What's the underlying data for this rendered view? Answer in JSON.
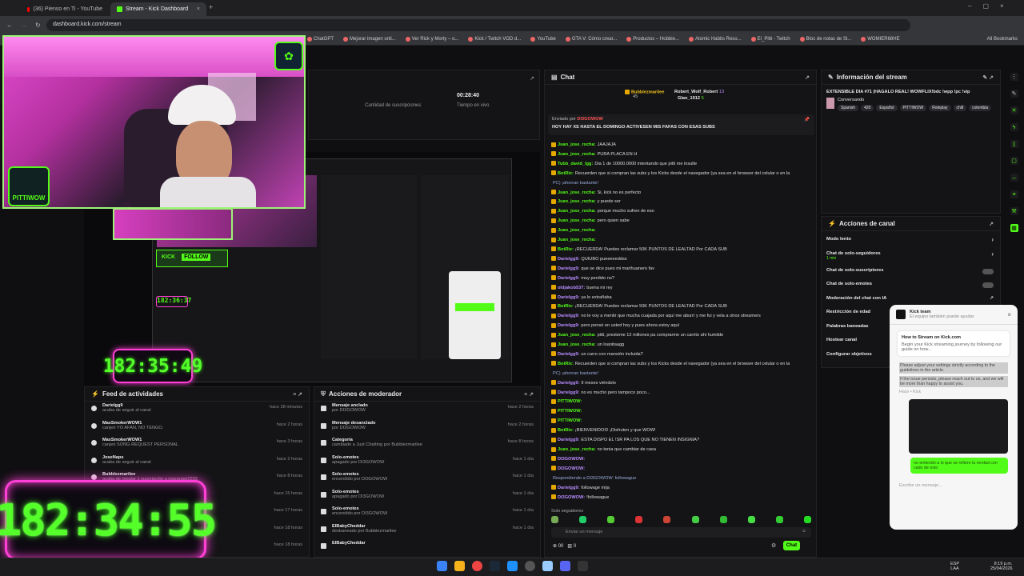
{
  "browser": {
    "tabs": [
      {
        "label": "(36) Pienso en Ti - YouTube",
        "active": false
      },
      {
        "label": "Stream - Kick Dashboard",
        "active": true
      }
    ],
    "url": "dashboard.kick.com/stream",
    "bookmarks": [
      "ChatGPT",
      "Mejorar imagen onli...",
      "Ver Rick y Morty – o...",
      "Kick / Twitch VOD d...",
      "YouTube",
      "GTA V: Cómo crear...",
      "Productos – Hobbie...",
      "Atomic Habits Reso...",
      "El_Pitti - Twitch",
      "Bloc de notas de Sl...",
      "WOMIER68HE"
    ],
    "all_bookmarks": "All Bookmarks"
  },
  "stats": {
    "subs_label": "Cantidad de suscripciones",
    "live_value": "00:28:40",
    "live_label": "Tiempo en vivo"
  },
  "chat": {
    "title": "Chat",
    "top1_name": "Bubblezmarilee",
    "top1_score": "45",
    "top2_name": "Robert_Wolf_Robert",
    "top2_score": "13",
    "top3_name": "Glan_1912",
    "top3_score": "5",
    "pinned_by": "Enviado por",
    "pinned_text": "HOY HAY XS HASTA EL DOMINGO ACTIVESEN MIS FAFAS CON ESAS SUBS",
    "messages": [
      {
        "user": "Juan_jose_rocha:",
        "text": "JAAJAJA",
        "kind": "u"
      },
      {
        "user": "Juan_jose_rocha:",
        "text": "PURA PLACA EN H",
        "kind": "u"
      },
      {
        "user": "Tubb_david_lgg:",
        "text": "Dia 1 de 10000.0000 intentando que pitti me insulte",
        "kind": "u"
      },
      {
        "user": "BotRix:",
        "text": "Recuerden que si compran las subs y los Kicks desde el navegador (ya sea en el browser del celular o en la",
        "kind": "b"
      },
      {
        "user": "",
        "text": "PC) ¡ahorran bastante!",
        "kind": "x"
      },
      {
        "user": "Juan_jose_rocha:",
        "text": "Si, kick no es perfecto",
        "kind": "u"
      },
      {
        "user": "Juan_jose_rocha:",
        "text": "y puede ser",
        "kind": "u"
      },
      {
        "user": "Juan_jose_rocha:",
        "text": "porque mucho sufren de eso",
        "kind": "u"
      },
      {
        "user": "Juan_jose_rocha:",
        "text": "pero quien sabe",
        "kind": "u"
      },
      {
        "user": "Juan_jose_rocha:",
        "text": "",
        "kind": "u"
      },
      {
        "user": "Juan_jose_rocha:",
        "text": "",
        "kind": "u"
      },
      {
        "user": "BotRix:",
        "text": "¡RECUERDA! Puedes reclamar 50K PUNTOS DE LEALTAD Por CADA SUB",
        "kind": "b"
      },
      {
        "user": "Darielgg9:",
        "text": "QUIUBO pueeeeeddss",
        "kind": "p"
      },
      {
        "user": "Darielgg9:",
        "text": "que se dice pues mi marihuanero fav",
        "kind": "p"
      },
      {
        "user": "Darielgg9:",
        "text": "muy perdido no?",
        "kind": "p"
      },
      {
        "user": "oldjakob537:",
        "text": "buena mi rey",
        "kind": "p"
      },
      {
        "user": "Darielgg9:",
        "text": "ya lo extrañaba",
        "kind": "p"
      },
      {
        "user": "BotRix:",
        "text": "¡RECUERDA! Puedes reclamar 50K PUNTOS DE LEALTAD Por CADA SUB",
        "kind": "b"
      },
      {
        "user": "Darielgg9:",
        "text": "no le voy a mentir que mucha cuajada por aquí me aburrí y me fui y vela a otros streamers",
        "kind": "p"
      },
      {
        "user": "Darielgg9:",
        "text": "pero pensé en usted hoy y pues ahora estoy aquí",
        "kind": "p"
      },
      {
        "user": "Juan_jose_rocha:",
        "text": "pitti, presteme 12 millones pa comprarme un carrito ahi humilde",
        "kind": "u"
      },
      {
        "user": "Juan_jose_rocha:",
        "text": "un loanitaagg",
        "kind": "u"
      },
      {
        "user": "Darielgg9:",
        "text": "un carro con mansión incluida?",
        "kind": "p"
      },
      {
        "user": "BotRix:",
        "text": "Recuerden que si compran las subs y los Kicks desde el navegador (ya sea en el browser del celular o en la",
        "kind": "b"
      },
      {
        "user": "",
        "text": "PC) ¡ahorran bastante!",
        "kind": "x"
      },
      {
        "user": "Darielgg9:",
        "text": "9 meses viéndolo",
        "kind": "p"
      },
      {
        "user": "Darielgg9:",
        "text": "no es mucho pero tampoco poco...",
        "kind": "p"
      },
      {
        "user": "PITTIWOW:",
        "text": "",
        "kind": "u"
      },
      {
        "user": "PITTIWOW:",
        "text": "",
        "kind": "u"
      },
      {
        "user": "PITTIWOW:",
        "text": "",
        "kind": "u"
      },
      {
        "user": "BotRix:",
        "text": "¡BIENVENIDOS! ¡Disfruten y que WOW!",
        "kind": "b"
      },
      {
        "user": "Darielgg9:",
        "text": "ESTA DISPO EL !SR PA LOS QUE NO TIENEN INSIGNIA?",
        "kind": "p"
      },
      {
        "user": "Juan_jose_rocha:",
        "text": "no tenia que cambiar de casa",
        "kind": "u"
      },
      {
        "user": "DI3GOWOW:",
        "text": "",
        "kind": "p"
      },
      {
        "user": "DI3GOWOW:",
        "text": "",
        "kind": "p"
      },
      {
        "user": "",
        "text": "Respondiendo a DI3GOWOW: followague",
        "kind": "x"
      },
      {
        "user": "Darielgg9:",
        "text": "followage mija",
        "kind": "p"
      },
      {
        "user": "DI3GOWOW:",
        "text": "!followague",
        "kind": "p"
      },
      {
        "user": "BotRix:",
        "text": "¡Sígueme en Instagram! Contenido exclusivo, adelantos y mucho más",
        "kind": "b"
      },
      {
        "user": "",
        "text": "https://www.instagram.com/pittiwow/",
        "kind": "x"
      }
    ],
    "followers_only": "Solo seguidores",
    "input_placeholder": "Enviar un mensaje",
    "points_a": "00",
    "points_b": "0",
    "send_label": "Chat"
  },
  "stream_info": {
    "title": "Información del stream",
    "stream_title": "EXTENSIBLE DIA #71 |HAGALO REAL! WOWFLIX!bdc !wpp !pc !vip",
    "category": "Conversando",
    "tags": [
      "Spanish",
      "420",
      "Español",
      "PITTIWOW",
      "Roleplay",
      "chill",
      "colombia"
    ]
  },
  "channel_actions": {
    "title": "Acciones de canal",
    "items": [
      {
        "label": "Modo lento",
        "control": "chevron"
      },
      {
        "label": "Chat de solo-seguidores",
        "sub": "1 min",
        "control": "chevron"
      },
      {
        "label": "Chat de solo-suscriptores",
        "control": "toggle"
      },
      {
        "label": "Chat de solo-emotes",
        "control": "toggle"
      },
      {
        "label": "Moderación del chat con IA",
        "control": "ext"
      },
      {
        "label": "Restricción de edad",
        "control": ""
      },
      {
        "label": "Palabras baneadas",
        "control": ""
      },
      {
        "label": "Hostear canal",
        "control": ""
      },
      {
        "label": "Configurar objetivos",
        "control": ""
      }
    ]
  },
  "activity": {
    "title": "Feed de actividades",
    "items": [
      {
        "name": "Darielgg9",
        "desc": "acaba de seguir al canal",
        "time": "hace 28 minutos"
      },
      {
        "name": "MaxSmokerWOW1",
        "desc": "canjeó YO AFAN, NO TENGO.",
        "time": "hace 2 horas"
      },
      {
        "name": "MaxSmokerWOW1",
        "desc": "canjeó SONG REQUEST PERSONAL",
        "time": "hace 3 horas"
      },
      {
        "name": "JoseNaps",
        "desc": "acaba de seguir al canal",
        "time": "hace 2 horas"
      },
      {
        "name": "Bubblezmarilee",
        "desc": "acaba de regalar 1 suscripción a joseangel2203",
        "time": "hace 8 horas"
      },
      {
        "name": "",
        "desc": "canjeó GP_JARED",
        "time": "hace 15 horas"
      },
      {
        "name": "",
        "desc": "PERSONAL",
        "time": "hace 17 horas"
      },
      {
        "name": "",
        "desc": "",
        "time": "hace 18 horas"
      },
      {
        "name": "",
        "desc": "",
        "time": "hace 18 horas"
      }
    ]
  },
  "modactions": {
    "title": "Acciones de moderador",
    "items": [
      {
        "name": "Mensaje anclado",
        "desc": "por DI3GOWOW",
        "time": "hace 2 horas"
      },
      {
        "name": "Mensaje desanclado",
        "desc": "por DI3GOWOW",
        "time": "hace 2 horas"
      },
      {
        "name": "Categoría",
        "desc": "cambiado a Just Chatting por Bubblezmarilee",
        "time": "hace 8 horas"
      },
      {
        "name": "Solo-emotes",
        "desc": "apagado por DI3GOWOW",
        "time": "hace 1 día"
      },
      {
        "name": "Solo-emotes",
        "desc": "encendido por DI3GOWOW",
        "time": "hace 1 día"
      },
      {
        "name": "Solo-emotes",
        "desc": "apagado por DI3GOWOW",
        "time": "hace 1 día"
      },
      {
        "name": "Solo-emotes",
        "desc": "encendido por DI3GOWOW",
        "time": "hace 1 día"
      },
      {
        "name": "ElBabyCheddar",
        "desc": "desbaneado por Bubblezmarilee",
        "time": "hace 1 día"
      },
      {
        "name": "ElBabyCheddar",
        "desc": "",
        "time": ""
      }
    ]
  },
  "overlay": {
    "big_timer": "182:34:55",
    "mid_timer": "182:35:49",
    "small_timer": "182:36:37",
    "logo_text": "PITTIWOW",
    "kick_badge": "KICK",
    "follow_label": "FOLLOW"
  },
  "popup": {
    "team": "Kick team",
    "subtitle": "El equipo también puede ayudar",
    "card_title": "How to Stream on Kick.com",
    "card_text": "Begin your Kick streaming journey by following our guide on how...",
    "body1": "Please adjust your settings strictly according to the guidelines in the article.",
    "body2": "If the issue persists, please reach out to us, and we will be more than happy to assist you.",
    "meta": "Hace • Kick",
    "green_msg": "no entiendo a lo que se refiere la verdad con cado de esto",
    "input_placeholder": "Escribe un mensaje..."
  },
  "taskbar": {
    "lang": "ESP",
    "lang2": "LAA",
    "time": "8:19 p.m.",
    "date": "25/04/2026"
  },
  "colors": {
    "accent": "#53fc18",
    "neon_pink": "#ff3fd6"
  }
}
